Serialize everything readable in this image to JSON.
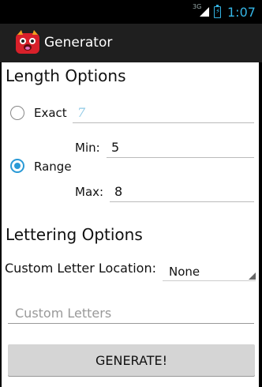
{
  "statusbar": {
    "network": "3G",
    "time": "1:07"
  },
  "actionbar": {
    "title": "Generator",
    "icon": "app-monster-icon"
  },
  "length": {
    "title": "Length Options",
    "exact_label": "Exact",
    "exact_value": "7",
    "range_label": "Range",
    "min_label": "Min:",
    "min_value": "5",
    "max_label": "Max:",
    "max_value": "8",
    "selected": "Range"
  },
  "lettering": {
    "title": "Lettering Options",
    "location_label": "Custom Letter Location:",
    "location_value": "None",
    "custom_placeholder": "Custom Letters"
  },
  "generate_label": "GENERATE!",
  "colors": {
    "accent": "#2a9ad6",
    "actionbar": "#1f1f1f",
    "statusbar_text": "#35b5e5"
  }
}
